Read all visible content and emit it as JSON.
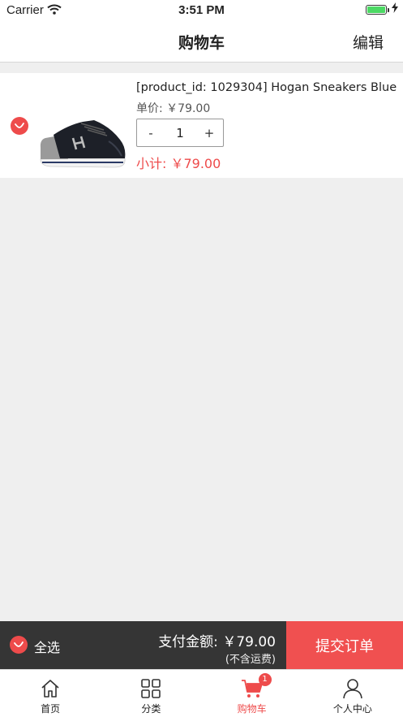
{
  "status_bar": {
    "carrier": "Carrier",
    "time": "3:51 PM"
  },
  "nav": {
    "title": "购物车",
    "edit_label": "编辑"
  },
  "cart": {
    "items": [
      {
        "name": "[product_id: 1029304] Hogan Sneakers Blue",
        "unit_price": "单价: ￥79.00",
        "quantity": "1",
        "minus": "-",
        "plus": "+",
        "subtotal": "小计: ￥79.00"
      }
    ]
  },
  "checkout": {
    "select_all": "全选",
    "total": "支付金额: ￥79.00",
    "note": "(不含运费)",
    "submit": "提交订单"
  },
  "tabs": [
    {
      "label": "首页",
      "icon": "home-icon"
    },
    {
      "label": "分类",
      "icon": "category-icon"
    },
    {
      "label": "购物车",
      "icon": "cart-icon",
      "badge": "1",
      "active": true
    },
    {
      "label": "个人中心",
      "icon": "user-icon"
    }
  ],
  "colors": {
    "accent": "#ee4b4b",
    "checkout_bar": "#353535",
    "submit": "#f05050"
  }
}
